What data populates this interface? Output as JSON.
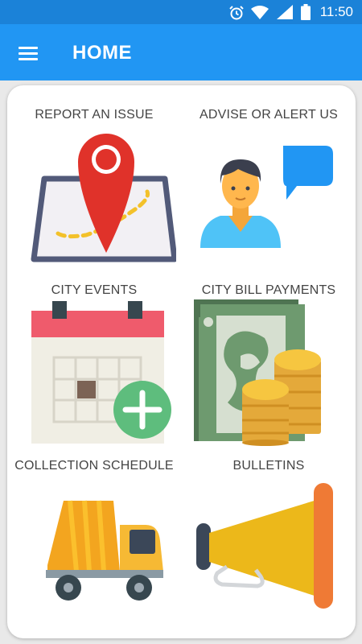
{
  "status_bar": {
    "time": "11:50"
  },
  "app_bar": {
    "title": "HOME"
  },
  "tiles": [
    {
      "label": "REPORT AN ISSUE",
      "icon": "map-pin-icon"
    },
    {
      "label": "ADVISE OR ALERT US",
      "icon": "person-speech-bubble-icon"
    },
    {
      "label": "CITY EVENTS",
      "icon": "calendar-add-icon"
    },
    {
      "label": "CITY BILL PAYMENTS",
      "icon": "money-coins-icon"
    },
    {
      "label": "COLLECTION SCHEDULE",
      "icon": "garbage-truck-icon"
    },
    {
      "label": "BULLETINS",
      "icon": "megaphone-icon"
    }
  ]
}
